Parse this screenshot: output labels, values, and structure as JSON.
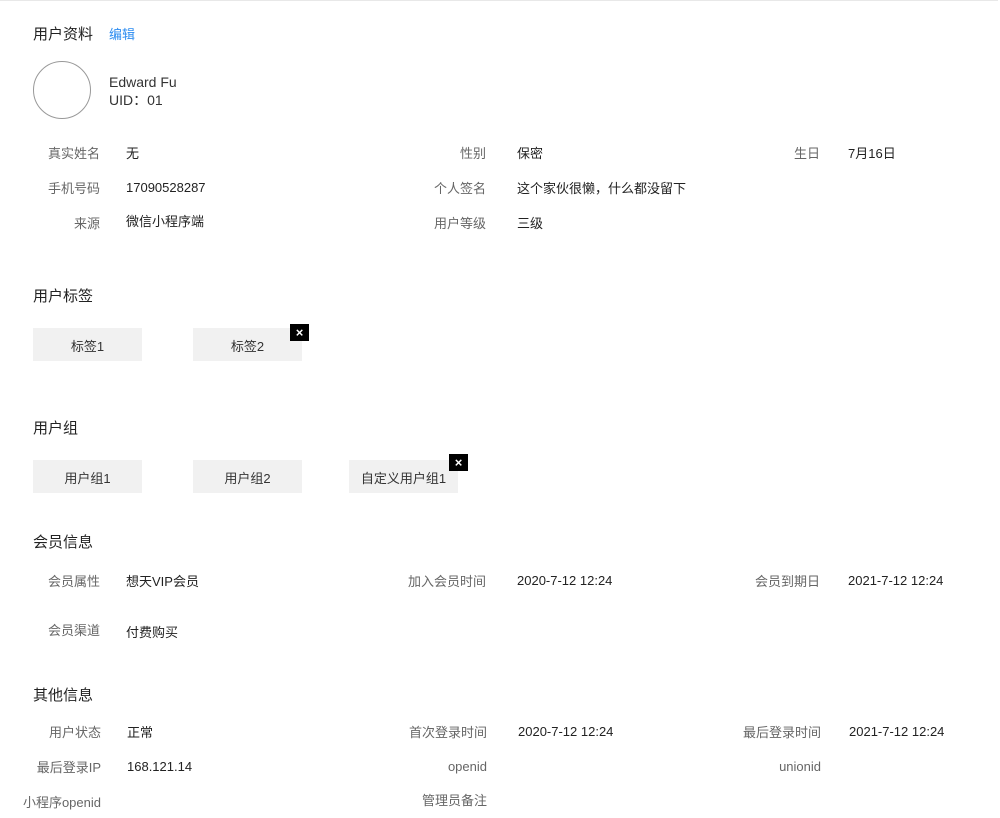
{
  "profile": {
    "title": "用户资料",
    "edit_label": "编辑",
    "name": "Edward Fu",
    "uid": "UID：01",
    "fields": [
      {
        "label": "真实姓名",
        "value": "无"
      },
      {
        "label": "性别",
        "value": "保密"
      },
      {
        "label": "生日",
        "value": "7月16日"
      },
      {
        "label": "手机号码",
        "value": "17090528287"
      },
      {
        "label": "个人签名",
        "value": "这个家伙很懒，什么都没留下"
      },
      {
        "label": "来源",
        "value": "微信小程序端"
      },
      {
        "label": "用户等级",
        "value": "三级"
      }
    ]
  },
  "tags": {
    "title": "用户标签",
    "items": [
      "标签1",
      "标签2"
    ],
    "close_icon": "×"
  },
  "groups": {
    "title": "用户组",
    "items": [
      "用户组1",
      "用户组2",
      "自定义用户组1"
    ],
    "close_icon": "×"
  },
  "membership": {
    "title": "会员信息",
    "fields": [
      {
        "label": "会员属性",
        "value": "想天VIP会员"
      },
      {
        "label": "加入会员时间",
        "value": "2020-7-12 12:24"
      },
      {
        "label": "会员到期日",
        "value": "2021-7-12 12:24"
      },
      {
        "label": "会员渠道",
        "value": "付费购买"
      }
    ]
  },
  "other": {
    "title": "其他信息",
    "fields": [
      {
        "label": "用户状态",
        "value": "正常"
      },
      {
        "label": "首次登录时间",
        "value": "2020-7-12 12:24"
      },
      {
        "label": "最后登录时间",
        "value": "2021-7-12 12:24"
      },
      {
        "label": "最后登录IP",
        "value": "168.121.14"
      },
      {
        "label": "openid",
        "value": ""
      },
      {
        "label": "unionid",
        "value": ""
      },
      {
        "label": "小程序openid",
        "value": ""
      },
      {
        "label": "管理员备注",
        "value": ""
      }
    ]
  }
}
